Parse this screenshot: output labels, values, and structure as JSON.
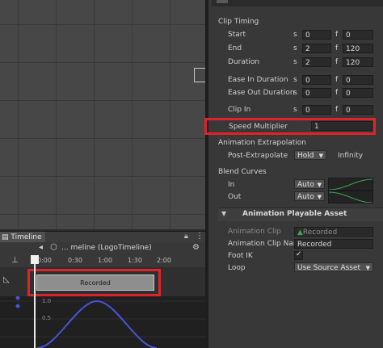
{
  "timeline": {
    "tab_label": "Timeline",
    "breadcrumb": "... meline (LogoTimeline)",
    "ruler_ticks": [
      "0:00",
      "0:30",
      "1:00",
      "1:30",
      "2:00"
    ],
    "clip_label": "Recorded",
    "curve_values": [
      "1.0",
      "0.5"
    ]
  },
  "inspector": {
    "section_clip_timing": "Clip Timing",
    "rows": [
      {
        "label": "Start",
        "s": "0",
        "f": "0"
      },
      {
        "label": "End",
        "s": "2",
        "f": "120"
      },
      {
        "label": "Duration",
        "s": "2",
        "f": "120"
      },
      {
        "label": "Ease In Duration",
        "s": "0",
        "f": "0"
      },
      {
        "label": "Ease Out Duration",
        "s": "0",
        "f": "0"
      },
      {
        "label": "Clip In",
        "s": "0",
        "f": "0"
      }
    ],
    "unit_s": "s",
    "unit_f": "f",
    "speed_label": "Speed Multiplier",
    "speed_value": "1",
    "section_extrapolation": "Animation Extrapolation",
    "post_extrapolate_label": "Post-Extrapolate",
    "post_extrapolate_value": "Hold",
    "infinity_label": "Infinity",
    "section_blend": "Blend Curves",
    "blend_in_label": "In",
    "blend_in_value": "Auto",
    "blend_out_label": "Out",
    "blend_out_value": "Auto",
    "asset_header": "Animation Playable Asset",
    "animation_clip_label": "Animation Clip",
    "animation_clip_value": "Recorded",
    "animation_clip_name_label": "Animation Clip Nar",
    "animation_clip_name_value": "Recorded",
    "foot_ik_label": "Foot IK",
    "loop_label": "Loop",
    "loop_value": "Use Source Asset"
  },
  "colors": {
    "highlight": "#e0232b",
    "curve": "#4a52d8",
    "blend_curve": "#3fa34d"
  }
}
